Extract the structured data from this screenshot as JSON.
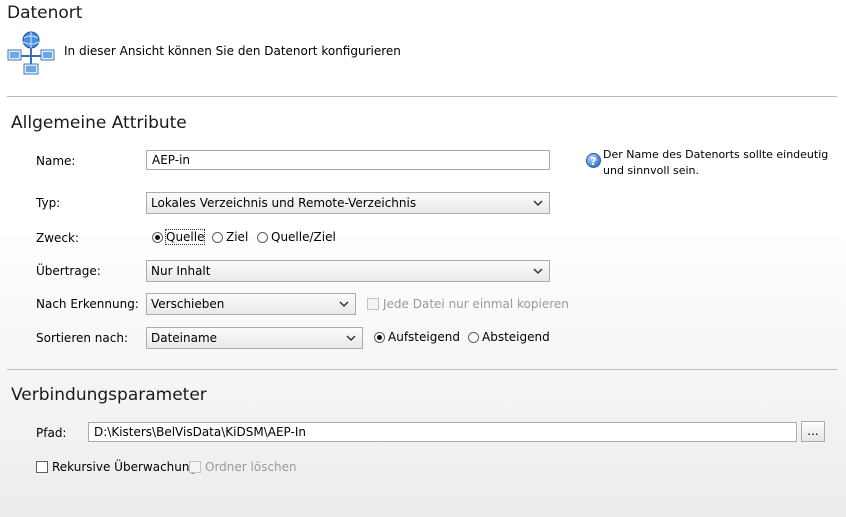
{
  "header": {
    "title": "Datenort",
    "description": "In dieser Ansicht können Sie den Datenort konfigurieren",
    "icon": "network-computers-icon"
  },
  "general": {
    "section_title": "Allgemeine Attribute",
    "name_label": "Name:",
    "name_value": "AEP-in",
    "hint": "Der Name des Datenorts sollte eindeutig und sinnvoll sein.",
    "type_label": "Typ:",
    "type_value": "Lokales Verzeichnis und Remote-Verzeichnis",
    "purpose_label": "Zweck:",
    "purpose_options": [
      "Quelle",
      "Ziel",
      "Quelle/Ziel"
    ],
    "purpose_selected": "Quelle",
    "transfer_label": "Übertrage:",
    "transfer_value": "Nur Inhalt",
    "after_detect_label": "Nach Erkennung:",
    "after_detect_value": "Verschieben",
    "copy_once_label": "Jede Datei nur einmal kopieren",
    "copy_once_checked": false,
    "sort_label": "Sortieren nach:",
    "sort_value": "Dateiname",
    "sort_asc_label": "Aufsteigend",
    "sort_desc_label": "Absteigend",
    "sort_direction": "Aufsteigend"
  },
  "connection": {
    "section_title": "Verbindungsparameter",
    "path_label": "Pfad:",
    "path_value": "D:\\Kisters\\BelVisData\\KiDSM\\AEP-In",
    "browse_label": "...",
    "recursive_label": "Rekursive Überwachung",
    "recursive_checked": false,
    "delete_folder_label": "Ordner löschen",
    "delete_folder_checked": false
  }
}
